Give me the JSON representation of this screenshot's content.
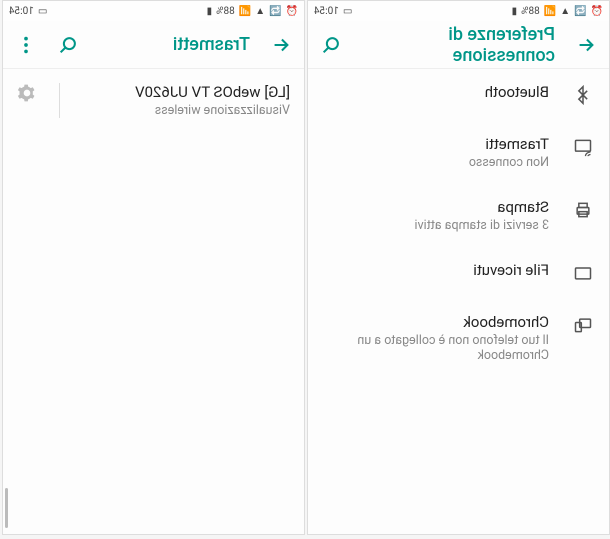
{
  "status": {
    "time": "10:54",
    "battery": "88%"
  },
  "screen1": {
    "title": "Preferenze di connessione",
    "items": [
      {
        "title": "Bluetooth",
        "sub": ""
      },
      {
        "title": "Trasmetti",
        "sub": "Non connesso"
      },
      {
        "title": "Stampa",
        "sub": "3 servizi di stampa attivi"
      },
      {
        "title": "File ricevuti",
        "sub": ""
      },
      {
        "title": "Chromebook",
        "sub": "Il tuo telefono non è collegato a un Chromebook"
      }
    ]
  },
  "screen2": {
    "title": "Trasmetti",
    "device": {
      "title": "[LG] webOS TV UJ620V",
      "sub": "Visualizzazione wireless"
    }
  }
}
